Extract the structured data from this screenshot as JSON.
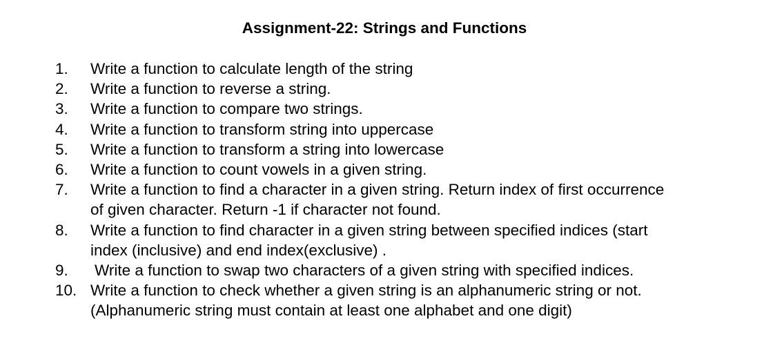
{
  "document": {
    "title": "Assignment-22: Strings and Functions",
    "items": [
      {
        "number": "1.",
        "lines": [
          "Write a function to calculate length of the string"
        ]
      },
      {
        "number": "2.",
        "lines": [
          "Write a function to reverse a string."
        ]
      },
      {
        "number": "3.",
        "lines": [
          "Write a function to compare two strings."
        ]
      },
      {
        "number": "4.",
        "lines": [
          "Write a function to transform string into uppercase"
        ]
      },
      {
        "number": "5.",
        "lines": [
          "Write a function to transform a string into lowercase"
        ]
      },
      {
        "number": "6.",
        "lines": [
          "Write a function to count vowels in a given string."
        ]
      },
      {
        "number": "7.",
        "lines": [
          "Write a function to find a character in a given string. Return index of first occurrence",
          "of given character. Return -1 if character not found."
        ]
      },
      {
        "number": "8.",
        "lines": [
          "Write a function to find character in a given string between specified indices (start",
          "index (inclusive) and end index(exclusive) ."
        ]
      },
      {
        "number": "9.",
        "lines": [
          "Write a function to swap two characters of a given string with specified indices."
        ]
      },
      {
        "number": "10.",
        "lines": [
          "Write a function to check whether a given string is an alphanumeric string or not.",
          "(Alphanumeric string must contain at least one alphabet and one digit)"
        ]
      }
    ]
  }
}
